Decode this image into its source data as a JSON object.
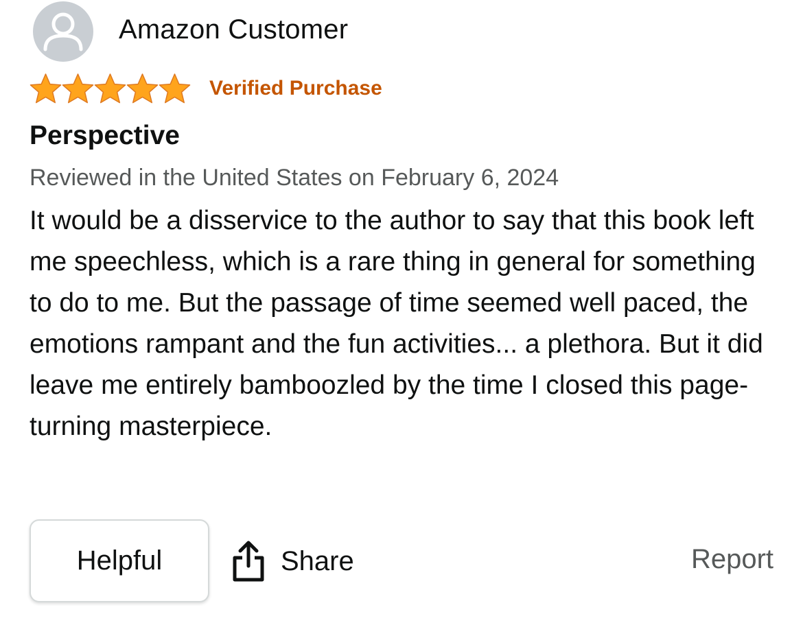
{
  "review": {
    "author": "Amazon Customer",
    "avatar_icon": "user-silhouette-icon",
    "rating": 5,
    "rating_max": 5,
    "star_color": "#ffa41c",
    "verified_label": "Verified Purchase",
    "verified_color": "#c45500",
    "title": "Perspective",
    "date_line": "Reviewed in the United States on February 6, 2024",
    "body": "It would be a disservice to the author to say that this book left me speechless, which is a rare thing in general for something to do to me. But the passage of time seemed well paced, the emotions rampant and the fun activities... a plethora. But it did leave me entirely bamboozled by the time I closed this page-turning masterpiece."
  },
  "actions": {
    "helpful_label": "Helpful",
    "share_label": "Share",
    "share_icon": "share-icon",
    "report_label": "Report"
  }
}
